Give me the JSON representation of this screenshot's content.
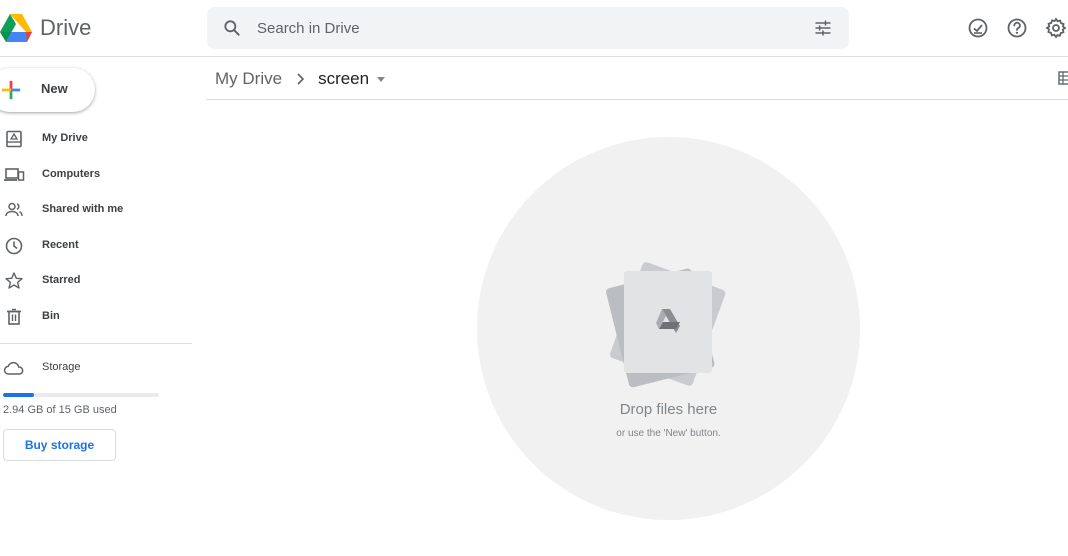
{
  "header": {
    "app_name": "Drive",
    "search_placeholder": "Search in Drive",
    "icons": [
      "drive-logo-icon",
      "search-icon",
      "search-options-icon",
      "offline-check-icon",
      "help-icon",
      "settings-icon"
    ]
  },
  "breadcrumb": {
    "root": "My Drive",
    "current": "screen"
  },
  "sidebar": {
    "new_label": "New",
    "items": [
      {
        "label": "My Drive",
        "icon": "my-drive-icon"
      },
      {
        "label": "Computers",
        "icon": "computers-icon"
      },
      {
        "label": "Shared with me",
        "icon": "shared-icon"
      },
      {
        "label": "Recent",
        "icon": "clock-icon"
      },
      {
        "label": "Starred",
        "icon": "star-icon"
      },
      {
        "label": "Bin",
        "icon": "trash-icon"
      }
    ],
    "storage": {
      "label": "Storage",
      "used_text": "2.94 GB of 15 GB used",
      "used_fraction": 0.196,
      "buy_label": "Buy storage"
    }
  },
  "empty_state": {
    "title": "Drop files here",
    "subtitle": "or use the 'New' button."
  },
  "colors": {
    "accent": "#1a73e8",
    "text": "#3c4043",
    "muted": "#5f6368",
    "search_bg": "#f1f3f4",
    "empty_circle": "#f1f1f1"
  }
}
